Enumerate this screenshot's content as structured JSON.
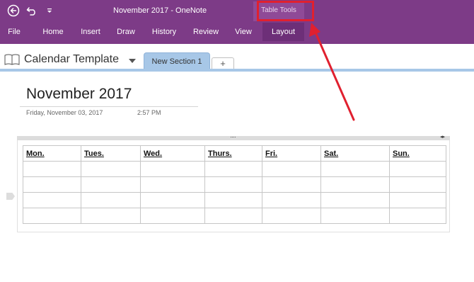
{
  "window": {
    "title": "November 2017  -  OneNote",
    "contextual_tools_label": "Table Tools",
    "accent_color": "#7d3b87"
  },
  "quick_access": {
    "back_icon": "back-arrow-circle-icon",
    "undo_icon": "undo-icon",
    "customize_icon": "customize-toolbar-icon"
  },
  "ribbon": {
    "tabs": [
      {
        "label": "File"
      },
      {
        "label": "Home"
      },
      {
        "label": "Insert"
      },
      {
        "label": "Draw"
      },
      {
        "label": "History"
      },
      {
        "label": "Review"
      },
      {
        "label": "View"
      },
      {
        "label": "Layout"
      }
    ],
    "active_tab": "Layout"
  },
  "notebook": {
    "name": "Calendar Template",
    "sections": [
      {
        "label": "New Section 1"
      }
    ],
    "add_section_label": "+"
  },
  "page": {
    "title": "November 2017",
    "date": "Friday, November 03, 2017",
    "time": "2:57 PM"
  },
  "calendar_table": {
    "headers": [
      "Mon.",
      "Tues.",
      "Wed.",
      "Thurs.",
      "Fri.",
      "Sat.",
      "Sun."
    ],
    "empty_rows": 4
  },
  "container": {
    "handle_dots": "····",
    "resize_arrows": "◂▸"
  }
}
